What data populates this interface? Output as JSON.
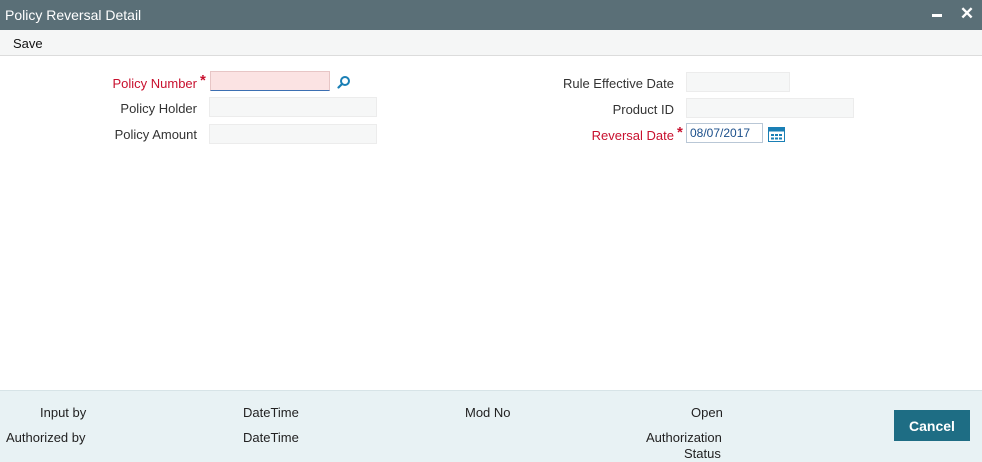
{
  "window": {
    "title": "Policy Reversal Detail"
  },
  "toolbar": {
    "save_label": "Save"
  },
  "form": {
    "policy_number": {
      "label": "Policy Number",
      "required_mark": "*",
      "value": ""
    },
    "policy_holder": {
      "label": "Policy Holder",
      "value": ""
    },
    "policy_amount": {
      "label": "Policy Amount",
      "value": ""
    },
    "rule_effective_date": {
      "label": "Rule Effective Date",
      "value": ""
    },
    "product_id": {
      "label": "Product ID",
      "value": ""
    },
    "reversal_date": {
      "label": "Reversal Date",
      "required_mark": "*",
      "value": "08/07/2017"
    }
  },
  "footer": {
    "input_by": "Input by",
    "datetime_1": "DateTime",
    "mod_no": "Mod No",
    "open": "Open",
    "authorized_by": "Authorized by",
    "datetime_2": "DateTime",
    "authorization_status_line1": "Authorization",
    "authorization_status_line2": "Status",
    "cancel_label": "Cancel"
  },
  "colors": {
    "titlebar": "#5a6f77",
    "required": "#c8102e",
    "footer": "#e8f2f4",
    "cancel_button": "#1e6d84",
    "link_icon": "#1a7fb5"
  }
}
